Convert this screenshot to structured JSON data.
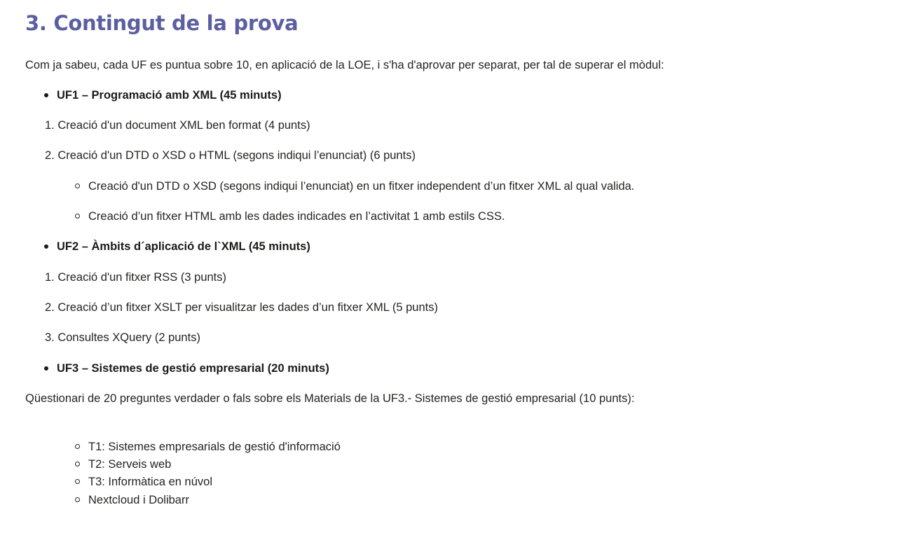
{
  "title": "3. Contingut de la prova",
  "intro": "Com ja sabeu, cada UF es puntua sobre 10, en aplicació de la LOE, i s'ha d'aprovar per separat, per tal de superar el mòdul:",
  "uf1": {
    "heading": "UF1 – Programació amb XML (45 minuts)",
    "items": [
      "1. Creació d'un document XML ben format (4 punts)",
      "2. Creació d'un DTD o XSD o HTML (segons indiqui l’enunciat) (6 punts)"
    ],
    "subitems": [
      "Creació d'un DTD o XSD (segons indiqui l’enunciat) en un fitxer independent d’un fitxer XML al qual valida.",
      "Creació d’un fitxer HTML amb les dades indicades en l’activitat 1 amb estils CSS."
    ]
  },
  "uf2": {
    "heading": "UF2 – Àmbits d´aplicació de l`XML (45 minuts)",
    "items": [
      "1. Creació d'un fitxer RSS (3 punts)",
      "2. Creació d’un fitxer XSLT per visualitzar les dades d’un fitxer XML (5 punts)",
      "3. Consultes XQuery (2 punts)"
    ]
  },
  "uf3": {
    "heading": "UF3 – Sistemes de gestió empresarial (20 minuts)",
    "description": "Qüestionari de 20 preguntes verdader o fals sobre els Materials de la UF3.- Sistemes de gestió empresarial (10 punts):",
    "topics": [
      "T1: Sistemes empresarials de gestió d'informació",
      "T2: Serveis web",
      "T3: Informàtica en núvol",
      "Nextcloud i Dolibarr"
    ]
  }
}
